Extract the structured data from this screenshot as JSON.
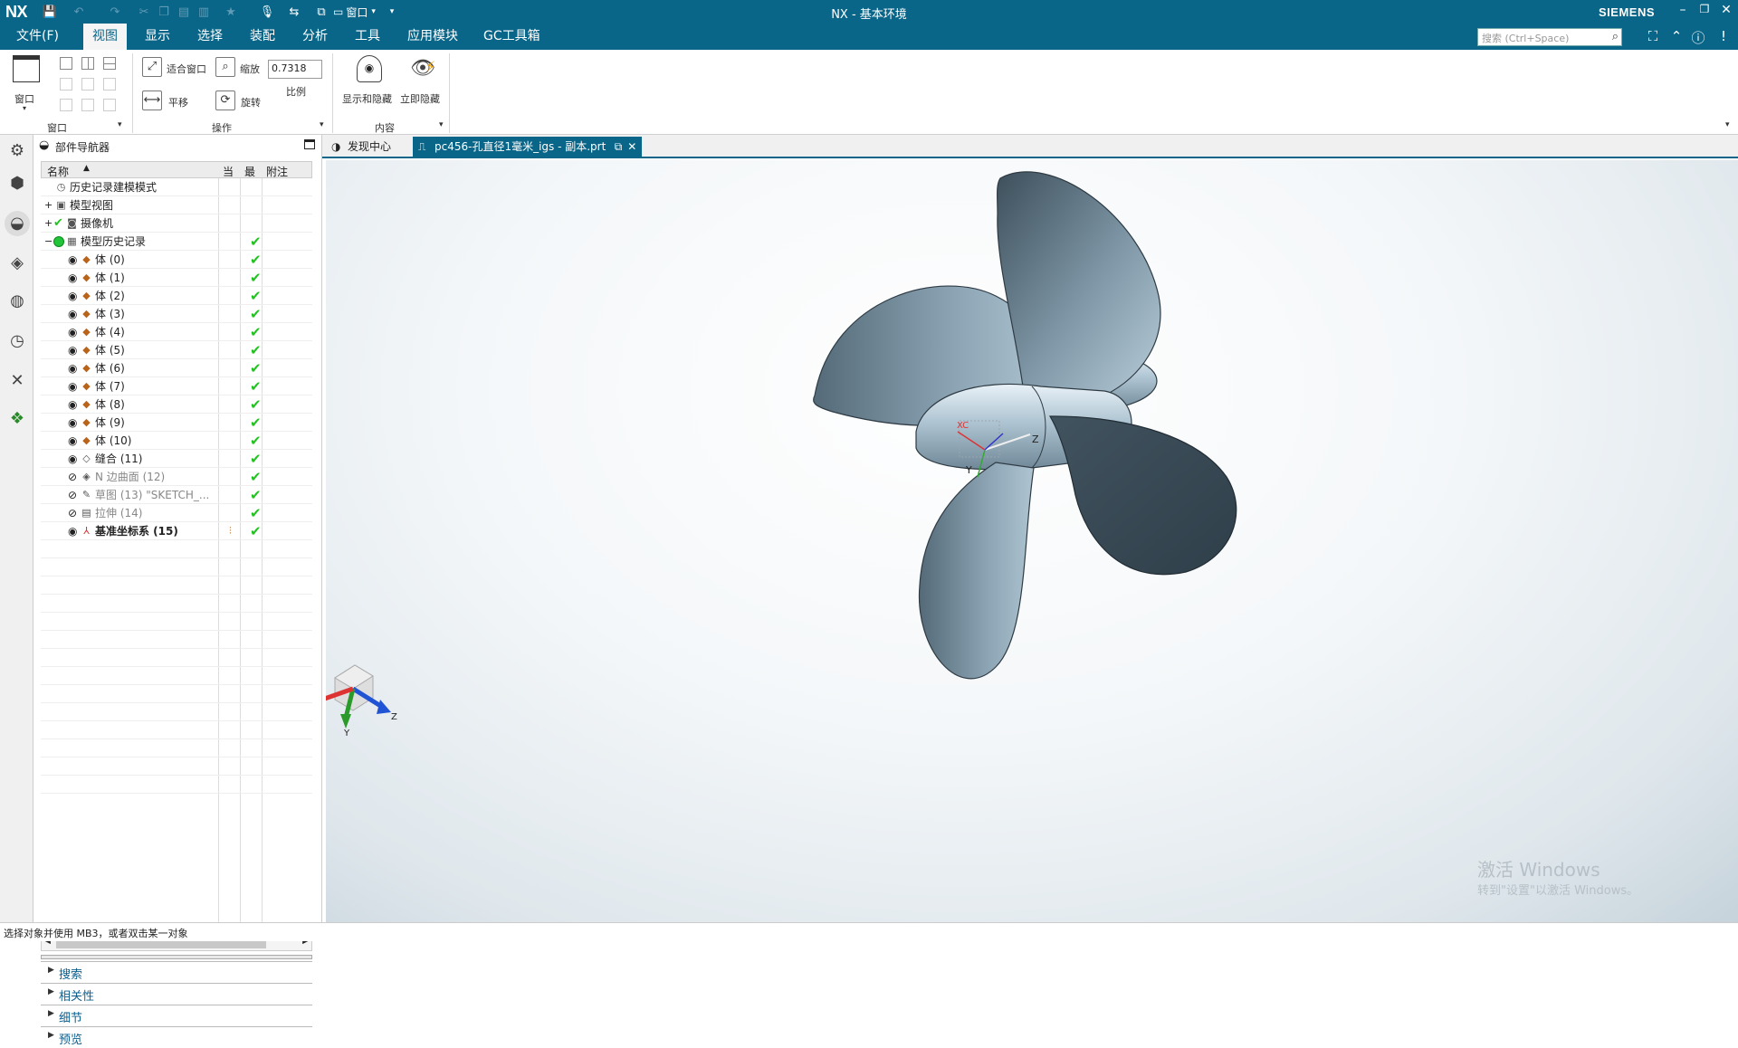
{
  "app": {
    "logo": "NX",
    "title": "NX - 基本环境",
    "brand": "SIEMENS",
    "quick_window_label": "窗口"
  },
  "menu": {
    "tabs": [
      "文件(F)",
      "视图",
      "显示",
      "选择",
      "装配",
      "分析",
      "工具",
      "应用模块",
      "GC工具箱"
    ],
    "active": "视图",
    "search_placeholder": "搜索 (Ctrl+Space)"
  },
  "ribbon": {
    "window_group": {
      "big_button": "窗口",
      "group_name": "窗口"
    },
    "operation_group": {
      "fit": "适合窗口",
      "zoom": "缩放",
      "zoom_value": "0.7318",
      "scale_label": "比例",
      "pan": "平移",
      "rotate": "旋转",
      "group_name": "操作"
    },
    "content_group": {
      "show_hide": "显示和隐藏",
      "instant_hide": "立即隐藏",
      "group_name": "内容"
    }
  },
  "navigator": {
    "title": "部件导航器",
    "columns": [
      "名称",
      "当",
      "最",
      "附注"
    ],
    "rows": [
      {
        "name": "历史记录建模模式",
        "indent": 0,
        "icon": "clock-icon",
        "expander": "",
        "check": false
      },
      {
        "name": "模型视图",
        "indent": 0,
        "icon": "view-icon",
        "expander": "+",
        "check": false
      },
      {
        "name": "摄像机",
        "indent": 0,
        "icon": "camera-icon",
        "expander": "+",
        "check": false,
        "tick": true
      },
      {
        "name": "模型历史记录",
        "indent": 0,
        "icon": "history-icon",
        "expander": "−",
        "check": true,
        "green": true
      },
      {
        "name": "体 (0)",
        "indent": 1,
        "icon": "body-icon",
        "check": true
      },
      {
        "name": "体 (1)",
        "indent": 1,
        "icon": "body-icon",
        "check": true
      },
      {
        "name": "体 (2)",
        "indent": 1,
        "icon": "body-icon",
        "check": true
      },
      {
        "name": "体 (3)",
        "indent": 1,
        "icon": "body-icon",
        "check": true
      },
      {
        "name": "体 (4)",
        "indent": 1,
        "icon": "body-icon",
        "check": true
      },
      {
        "name": "体 (5)",
        "indent": 1,
        "icon": "body-icon",
        "check": true
      },
      {
        "name": "体 (6)",
        "indent": 1,
        "icon": "body-icon",
        "check": true
      },
      {
        "name": "体 (7)",
        "indent": 1,
        "icon": "body-icon",
        "check": true
      },
      {
        "name": "体 (8)",
        "indent": 1,
        "icon": "body-icon",
        "check": true
      },
      {
        "name": "体 (9)",
        "indent": 1,
        "icon": "body-icon",
        "check": true
      },
      {
        "name": "体 (10)",
        "indent": 1,
        "icon": "body-icon",
        "check": true
      },
      {
        "name": "缝合 (11)",
        "indent": 1,
        "icon": "sew-icon",
        "check": true
      },
      {
        "name": "N 边曲面 (12)",
        "indent": 1,
        "icon": "nsurface-icon",
        "check": true,
        "dim": true
      },
      {
        "name": "草图 (13) \"SKETCH_...",
        "indent": 1,
        "icon": "sketch-icon",
        "check": true,
        "dim": true
      },
      {
        "name": "拉伸 (14)",
        "indent": 1,
        "icon": "extrude-icon",
        "check": true,
        "dim": true
      },
      {
        "name": "基准坐标系 (15)",
        "indent": 1,
        "icon": "datum-csys-icon",
        "check": true,
        "bold": true
      }
    ],
    "panels": [
      "搜索",
      "相关性",
      "细节",
      "预览"
    ]
  },
  "doc_tabs": [
    {
      "label": "发现中心",
      "active": false
    },
    {
      "label": "pc456-孔直径1毫米_igs - 副本.prt",
      "active": true
    }
  ],
  "viewport": {
    "triad": {
      "x": "X",
      "y": "Y",
      "z": "Z"
    },
    "wcs": {
      "xc": "XC",
      "y": "Y",
      "z": "Z"
    },
    "watermark_line1": "激活 Windows",
    "watermark_line2": "转到\"设置\"以激活 Windows。"
  },
  "status": "选择对象并使用 MB3，或者双击某一对象",
  "colors": {
    "titlebar": "#0a6689",
    "blade_dark": "#3f525e",
    "blade_light": "#b9cedb",
    "check": "#1fc41f"
  }
}
